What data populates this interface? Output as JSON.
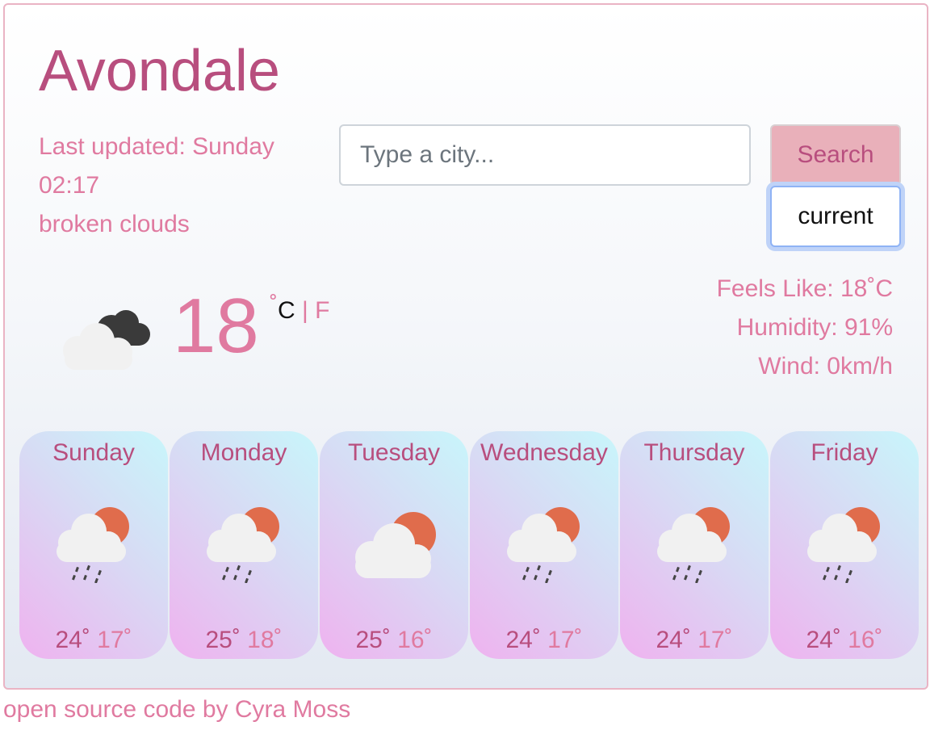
{
  "weather": {
    "city": "Avondale",
    "last_updated": "Last updated: Sunday 02:17",
    "last_updated_line1": "Last updated: Sunday",
    "last_updated_line2": "02:17",
    "description": "broken clouds",
    "temperature": "18",
    "degree_symbol": "˚",
    "unit_celsius": "C",
    "unit_separator": "|",
    "unit_fahrenheit": "F",
    "icon": "broken-clouds-icon",
    "feels_like": "Feels Like: 18˚C",
    "humidity": "Humidity: 91%",
    "wind": "Wind: 0km/h"
  },
  "search": {
    "placeholder": "Type a city...",
    "button_label": "Search",
    "current_label": "current"
  },
  "forecast": [
    {
      "day": "Sunday",
      "icon": "rain-sun-icon",
      "max": "24˚",
      "min": "17˚"
    },
    {
      "day": "Monday",
      "icon": "rain-sun-icon",
      "max": "25˚",
      "min": "18˚"
    },
    {
      "day": "Tuesday",
      "icon": "cloud-sun-icon",
      "max": "25˚",
      "min": "16˚"
    },
    {
      "day": "Wednesday",
      "icon": "rain-sun-icon",
      "max": "24˚",
      "min": "17˚"
    },
    {
      "day": "Thursday",
      "icon": "rain-sun-icon",
      "max": "24˚",
      "min": "17˚"
    },
    {
      "day": "Friday",
      "icon": "rain-sun-icon",
      "max": "24˚",
      "min": "16˚"
    }
  ],
  "footer": {
    "text": "open source code by Cyra Moss"
  },
  "colors": {
    "accent": "#b84e7e",
    "accent_light": "#e07aa0",
    "button_bg": "#e9b0ba",
    "sun": "#e06c4c"
  }
}
